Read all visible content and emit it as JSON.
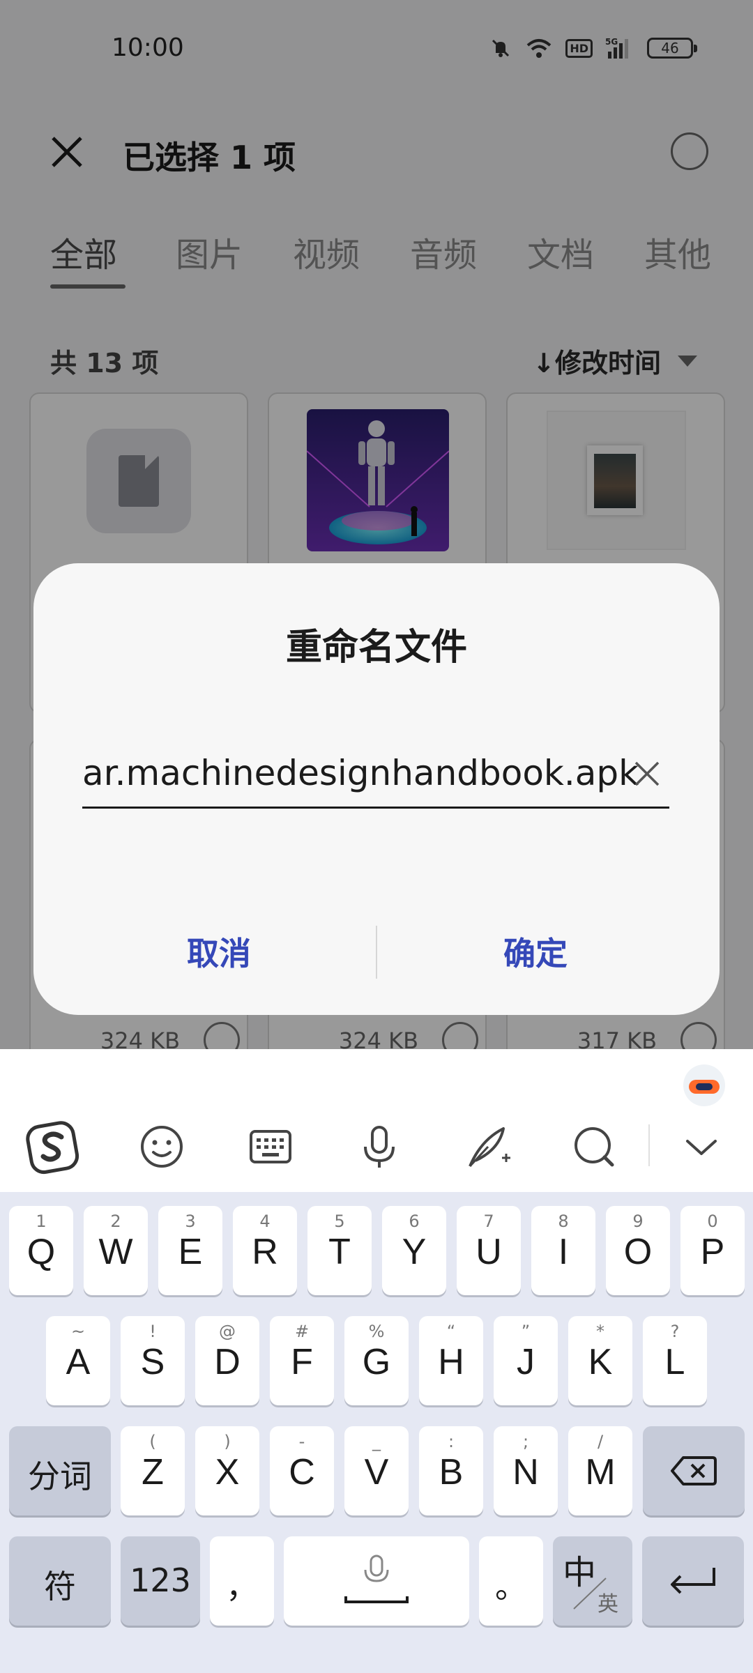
{
  "status_bar": {
    "time": "10:00",
    "network": "5G",
    "hd": "HD",
    "battery": "46"
  },
  "header": {
    "title": "已选择 1 项"
  },
  "tabs": [
    {
      "label": "全部",
      "active": true
    },
    {
      "label": "图片",
      "active": false
    },
    {
      "label": "视频",
      "active": false
    },
    {
      "label": "音频",
      "active": false
    },
    {
      "label": "文档",
      "active": false
    },
    {
      "label": "其他",
      "active": false
    }
  ],
  "list_meta": {
    "count": "共 13 项",
    "sort": "↓修改时间"
  },
  "files": {
    "row2_sizes": [
      "324 KB",
      "324 KB",
      "317 KB"
    ]
  },
  "dialog": {
    "title": "重命名文件",
    "input_value": "ar.machinedesignhandbook.apk",
    "cancel_label": "取消",
    "ok_label": "确定"
  },
  "keyboard": {
    "row1": [
      {
        "sub": "1",
        "main": "Q"
      },
      {
        "sub": "2",
        "main": "W"
      },
      {
        "sub": "3",
        "main": "E"
      },
      {
        "sub": "4",
        "main": "R"
      },
      {
        "sub": "5",
        "main": "T"
      },
      {
        "sub": "6",
        "main": "Y"
      },
      {
        "sub": "7",
        "main": "U"
      },
      {
        "sub": "8",
        "main": "I"
      },
      {
        "sub": "9",
        "main": "O"
      },
      {
        "sub": "0",
        "main": "P"
      }
    ],
    "row2": [
      {
        "sub": "~",
        "main": "A"
      },
      {
        "sub": "!",
        "main": "S"
      },
      {
        "sub": "@",
        "main": "D"
      },
      {
        "sub": "#",
        "main": "F"
      },
      {
        "sub": "%",
        "main": "G"
      },
      {
        "sub": "“",
        "main": "H"
      },
      {
        "sub": "”",
        "main": "J"
      },
      {
        "sub": "*",
        "main": "K"
      },
      {
        "sub": "?",
        "main": "L"
      }
    ],
    "row3": [
      {
        "sub": "(",
        "main": "Z"
      },
      {
        "sub": ")",
        "main": "X"
      },
      {
        "sub": "-",
        "main": "C"
      },
      {
        "sub": "_",
        "main": "V"
      },
      {
        "sub": ":",
        "main": "B"
      },
      {
        "sub": ";",
        "main": "N"
      },
      {
        "sub": "/",
        "main": "M"
      }
    ],
    "fenci_label": "分词",
    "symbol_label": "符",
    "num_label": "123",
    "comma_label": "，",
    "period_label": "。",
    "lang_main": "中",
    "lang_sub": "英"
  },
  "colors": {
    "accent": "#3548b8",
    "scrim": "#000000",
    "keyboard_bg": "#e5e8f3"
  }
}
